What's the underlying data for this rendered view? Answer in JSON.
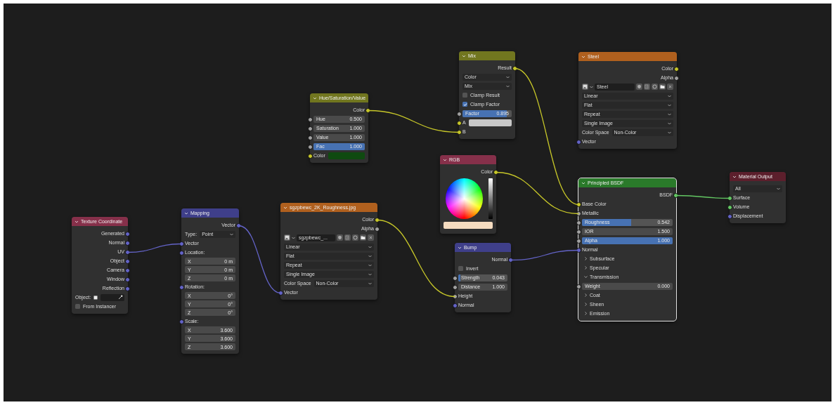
{
  "nodes": [
    {
      "title": "Texture Coordinate",
      "color": "#86304a",
      "selected": false,
      "rows": [
        {
          "kind": "output",
          "label": "Generated",
          "color": "#6363c7"
        },
        {
          "kind": "output",
          "label": "Normal",
          "color": "#6363c7"
        },
        {
          "kind": "output",
          "label": "UV",
          "color": "#6363c7"
        },
        {
          "kind": "output",
          "label": "Object",
          "color": "#6363c7"
        },
        {
          "kind": "output",
          "label": "Camera",
          "color": "#6363c7"
        },
        {
          "kind": "output",
          "label": "Window",
          "color": "#6363c7"
        },
        {
          "kind": "output",
          "label": "Reflection",
          "color": "#6363c7"
        },
        {
          "kind": "object",
          "label": "Object:"
        },
        {
          "kind": "checkbox",
          "label": "From Instancer",
          "checked": false
        }
      ]
    },
    {
      "title": "Mapping",
      "color": "#3f3f8a",
      "selected": false,
      "rows": [
        {
          "kind": "output",
          "label": "Vector",
          "color": "#6363c7"
        },
        {
          "kind": "dropdown",
          "label": "Type:",
          "value": "Point"
        },
        {
          "kind": "input",
          "label": "Vector",
          "color": "#6363c7"
        },
        {
          "kind": "input",
          "label": "Location:",
          "color": "#6363c7"
        },
        {
          "kind": "field",
          "label": "X",
          "value": "0 m"
        },
        {
          "kind": "field",
          "label": "Y",
          "value": "0 m"
        },
        {
          "kind": "field",
          "label": "Z",
          "value": "0 m"
        },
        {
          "kind": "input",
          "label": "Rotation:",
          "color": "#6363c7"
        },
        {
          "kind": "field",
          "label": "X",
          "value": "0°"
        },
        {
          "kind": "field",
          "label": "Y",
          "value": "0°"
        },
        {
          "kind": "field",
          "label": "Z",
          "value": "0°"
        },
        {
          "kind": "input",
          "label": "Scale:",
          "color": "#6363c7"
        },
        {
          "kind": "field",
          "label": "X",
          "value": "3.600"
        },
        {
          "kind": "field",
          "label": "Y",
          "value": "3.600"
        },
        {
          "kind": "field",
          "label": "Z",
          "value": "3.600"
        }
      ]
    },
    {
      "title": "Hue/Saturation/Value",
      "color": "#71761f",
      "selected": false,
      "rows": [
        {
          "kind": "output",
          "label": "Color",
          "color": "#c7c729"
        },
        {
          "kind": "field",
          "label": "Hue",
          "value": "0.500",
          "color": "#a1a1a1"
        },
        {
          "kind": "field",
          "label": "Saturation",
          "value": "1.000",
          "color": "#a1a1a1"
        },
        {
          "kind": "field",
          "label": "Value",
          "value": "1.000",
          "color": "#a1a1a1"
        },
        {
          "kind": "slider",
          "label": "Fac",
          "value": "1.000",
          "level": 1,
          "color": "#a1a1a1"
        },
        {
          "kind": "color",
          "label": "Color",
          "swatch": {
            "color": "#0f4a10"
          },
          "color": "#c7c729"
        }
      ]
    },
    {
      "title": "sgzpbewc_2K_Roughness.jpg",
      "color": "#b0601e",
      "selected": false,
      "rows": [
        {
          "kind": "output",
          "label": "Color",
          "color": "#c7c729"
        },
        {
          "kind": "output",
          "label": "Alpha",
          "color": "#a1a1a1"
        },
        {
          "kind": "image",
          "value": "sgzpbewc_..."
        },
        {
          "kind": "dropdown",
          "value": "Linear"
        },
        {
          "kind": "dropdown",
          "value": "Flat"
        },
        {
          "kind": "dropdown",
          "value": "Repeat"
        },
        {
          "kind": "dropdown",
          "value": "Single Image"
        },
        {
          "kind": "dropdown",
          "label": "Color Space",
          "value": "Non-Color"
        },
        {
          "kind": "input",
          "label": "Vector",
          "color": "#6363c7"
        }
      ]
    },
    {
      "title": "Mix",
      "color": "#71761f",
      "selected": false,
      "rows": [
        {
          "kind": "output",
          "label": "Result",
          "color": "#c7c729"
        },
        {
          "kind": "dropdown",
          "value": "Color"
        },
        {
          "kind": "dropdown",
          "value": "Mix"
        },
        {
          "kind": "checkbox",
          "label": "Clamp Result",
          "checked": false
        },
        {
          "kind": "checkbox",
          "label": "Clamp Factor",
          "checked": true
        },
        {
          "kind": "slider",
          "label": "Factor",
          "value": "0.895",
          "level": 0.895,
          "color": "#a1a1a1"
        },
        {
          "kind": "color",
          "label": "A",
          "swatch": {
            "color": "#c8c8c8"
          },
          "color": "#c7c729"
        },
        {
          "kind": "input",
          "label": "B",
          "color": "#c7c729"
        }
      ]
    },
    {
      "title": "RGB",
      "color": "#86304a",
      "selected": false,
      "rows": [
        {
          "kind": "output",
          "label": "Color",
          "color": "#c7c729"
        },
        {
          "kind": "wheel",
          "swatch": {
            "color": "#f5dcc0"
          }
        }
      ]
    },
    {
      "title": "Bump",
      "color": "#3f3f8a",
      "selected": false,
      "rows": [
        {
          "kind": "output",
          "label": "Normal",
          "color": "#6363c7"
        },
        {
          "kind": "checkbox",
          "label": "Invert",
          "checked": false
        },
        {
          "kind": "slider",
          "label": "Strength",
          "value": "0.043",
          "level": 0.043,
          "color": "#a1a1a1"
        },
        {
          "kind": "field",
          "label": "Distance",
          "value": "1.000",
          "color": "#a1a1a1"
        },
        {
          "kind": "input",
          "label": "Height",
          "color": "#a1a1a1"
        },
        {
          "kind": "input",
          "label": "Normal",
          "color": "#6363c7"
        }
      ]
    },
    {
      "title": "Steel",
      "color": "#b0601e",
      "selected": false,
      "rows": [
        {
          "kind": "output",
          "label": "Color",
          "color": "#c7c729"
        },
        {
          "kind": "output",
          "label": "Alpha",
          "color": "#a1a1a1"
        },
        {
          "kind": "image",
          "value": "Steel"
        },
        {
          "kind": "dropdown",
          "value": "Linear"
        },
        {
          "kind": "dropdown",
          "value": "Flat"
        },
        {
          "kind": "dropdown",
          "value": "Repeat"
        },
        {
          "kind": "dropdown",
          "value": "Single Image"
        },
        {
          "kind": "dropdown",
          "label": "Color Space",
          "value": "Non-Color"
        },
        {
          "kind": "input",
          "label": "Vector",
          "color": "#6363c7"
        }
      ]
    },
    {
      "title": "Principled BSDF",
      "color": "#2a7a2a",
      "selected": true,
      "rows": [
        {
          "kind": "output",
          "label": "BSDF",
          "color": "#63c763"
        },
        {
          "kind": "input",
          "label": "Base Color",
          "color": "#c7c729"
        },
        {
          "kind": "input",
          "label": "Metallic",
          "color": "#a1a1a1"
        },
        {
          "kind": "slider",
          "label": "Roughness",
          "value": "0.542",
          "level": 0.542,
          "color": "#a1a1a1"
        },
        {
          "kind": "field",
          "label": "IOR",
          "value": "1.500",
          "color": "#a1a1a1"
        },
        {
          "kind": "slider",
          "label": "Alpha",
          "value": "1.000",
          "level": 1,
          "color": "#a1a1a1"
        },
        {
          "kind": "input",
          "label": "Normal",
          "color": "#6363c7"
        },
        {
          "kind": "panel",
          "label": "Subsurface",
          "expanded": false
        },
        {
          "kind": "panel",
          "label": "Specular",
          "expanded": false
        },
        {
          "kind": "panel",
          "label": "Transmission",
          "expanded": true
        },
        {
          "kind": "field",
          "label": "Weight",
          "value": "0.000",
          "color": "#a1a1a1"
        },
        {
          "kind": "panel",
          "label": "Coat",
          "expanded": false
        },
        {
          "kind": "panel",
          "label": "Sheen",
          "expanded": false
        },
        {
          "kind": "panel",
          "label": "Emission",
          "expanded": false
        }
      ]
    },
    {
      "title": "Material Output",
      "color": "#5c1f2c",
      "selected": false,
      "rows": [
        {
          "kind": "dropdown",
          "value": "All"
        },
        {
          "kind": "input",
          "label": "Surface",
          "color": "#63c763"
        },
        {
          "kind": "input",
          "label": "Volume",
          "color": "#63c763"
        },
        {
          "kind": "input",
          "label": "Displacement",
          "color": "#6363c7"
        }
      ]
    }
  ]
}
